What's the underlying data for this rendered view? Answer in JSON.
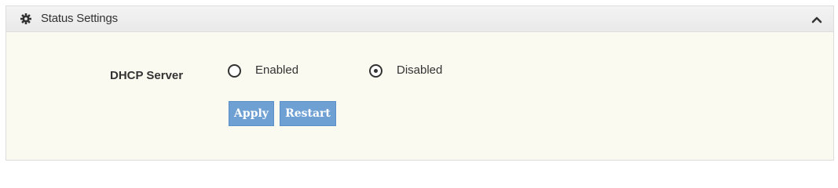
{
  "panel": {
    "title": "Status Settings",
    "icon": "gear-icon",
    "collapse_icon": "chevron-up-icon"
  },
  "dhcp": {
    "label": "DHCP Server",
    "options": [
      {
        "label": "Enabled",
        "checked": false
      },
      {
        "label": "Disabled",
        "checked": true
      }
    ]
  },
  "buttons": {
    "apply_label": "Apply",
    "restart_label": "Restart"
  },
  "colors": {
    "button": "#6ea0d4",
    "panel_bg": "#fafaf0"
  }
}
